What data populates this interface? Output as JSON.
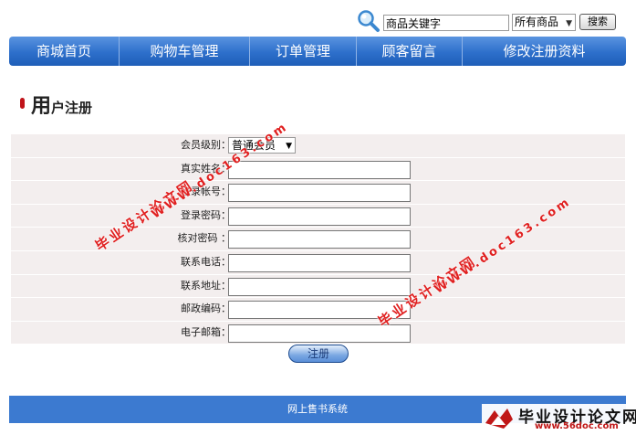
{
  "search": {
    "placeholder": "商品关键字",
    "category_selected": "所有商品",
    "button_label": "搜索"
  },
  "nav": {
    "items": [
      {
        "label": "商城首页"
      },
      {
        "label": "购物车管理"
      },
      {
        "label": "订单管理"
      },
      {
        "label": "顾客留言"
      },
      {
        "label": "修改注册资料"
      }
    ]
  },
  "page_title": {
    "big_char": "用",
    "rest": "户注册"
  },
  "form": {
    "level_label": "会员级别：",
    "level_value": "普通会员",
    "fields": [
      {
        "label": "真实姓名："
      },
      {
        "label": "登录帐号："
      },
      {
        "label": "登录密码："
      },
      {
        "label": "核对密码 ："
      },
      {
        "label": "联系电话："
      },
      {
        "label": "联系地址："
      },
      {
        "label": "邮政编码："
      },
      {
        "label": "电子邮箱："
      }
    ],
    "submit_label": "注册"
  },
  "footer": {
    "text": "网上售书系统"
  },
  "watermark": {
    "cn": "毕业设计论文网",
    "url_upper": "WWW.doc163.com",
    "corner_url": "www.56doc.com"
  },
  "colors": {
    "nav_blue": "#2d6fcb",
    "footer_blue": "#3c7ad0",
    "row_shade": "#f3eeee",
    "watermark_red": "#e02020"
  }
}
